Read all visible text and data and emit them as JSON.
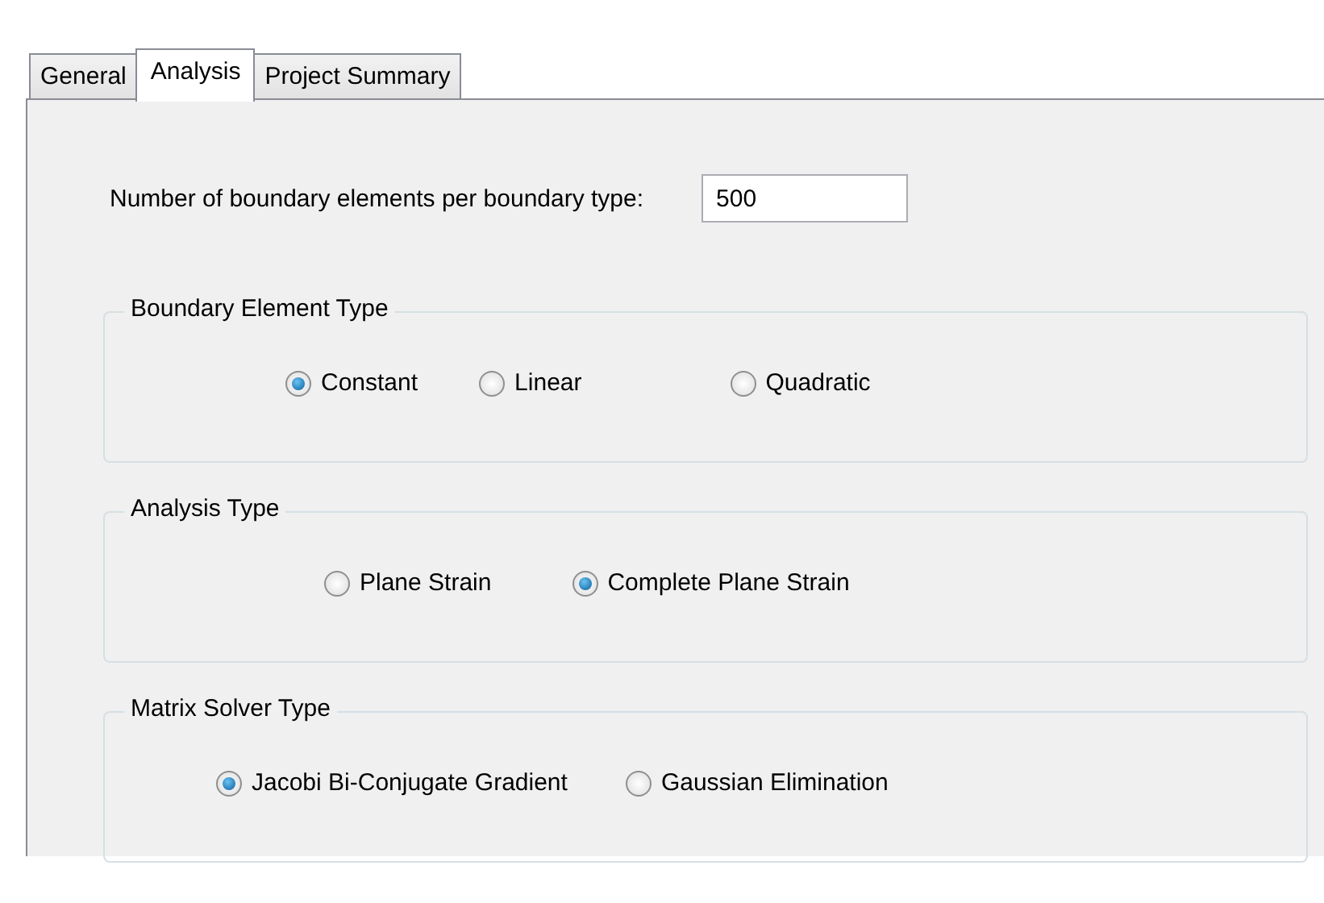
{
  "tabs": [
    {
      "label": "General",
      "selected": false
    },
    {
      "label": "Analysis",
      "selected": true
    },
    {
      "label": "Project Summary",
      "selected": false
    }
  ],
  "elements_field": {
    "label": "Number of boundary elements per boundary type:",
    "value": "500"
  },
  "groups": [
    {
      "title": "Boundary Element Type",
      "options": [
        {
          "label": "Constant",
          "selected": true
        },
        {
          "label": "Linear",
          "selected": false
        },
        {
          "label": "Quadratic",
          "selected": false
        }
      ]
    },
    {
      "title": "Analysis Type",
      "options": [
        {
          "label": "Plane Strain",
          "selected": false
        },
        {
          "label": "Complete Plane Strain",
          "selected": true
        }
      ]
    },
    {
      "title": "Matrix Solver Type",
      "options": [
        {
          "label": "Jacobi Bi-Conjugate Gradient",
          "selected": true
        },
        {
          "label": "Gaussian Elimination",
          "selected": false
        }
      ]
    }
  ]
}
